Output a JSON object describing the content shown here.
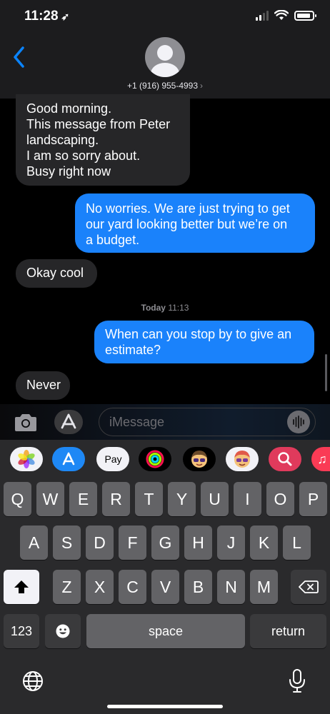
{
  "status_bar": {
    "time": "11:28",
    "location_arrow": "location-arrow-icon"
  },
  "contact": {
    "number": "+1 (916) 955-4993",
    "chevron": "›",
    "back_icon": "chevron-left-icon"
  },
  "messages": [
    {
      "direction": "in",
      "lines": [
        "Good morning.",
        "This message from Peter",
        "landscaping.",
        "I am so sorry about.",
        "Busy right now"
      ]
    },
    {
      "direction": "out",
      "lines": [
        "No worries. We are just trying to get",
        "our yard looking better but we’re on",
        "a budget."
      ]
    },
    {
      "direction": "in",
      "lines": [
        "Okay cool"
      ]
    },
    {
      "direction": "out",
      "lines": [
        "When can you stop by to give an",
        "estimate?"
      ]
    },
    {
      "direction": "in",
      "lines": [
        "Never"
      ]
    }
  ],
  "timestamp": {
    "day": "Today",
    "time": "11:13"
  },
  "input": {
    "placeholder": "iMessage",
    "value": ""
  },
  "app_strip": [
    "photos-icon",
    "app-store-icon",
    "apple-pay-icon",
    "activity-icon",
    "memoji-icon",
    "memoji-stickers-icon",
    "image-search-icon",
    "music-icon"
  ],
  "apple_pay_label": "Pay",
  "keyboard": {
    "row1": [
      "Q",
      "W",
      "E",
      "R",
      "T",
      "Y",
      "U",
      "I",
      "O",
      "P"
    ],
    "row2": [
      "A",
      "S",
      "D",
      "F",
      "G",
      "H",
      "J",
      "K",
      "L"
    ],
    "row3": [
      "Z",
      "X",
      "C",
      "V",
      "B",
      "N",
      "M"
    ],
    "numbers_label": "123",
    "space_label": "space",
    "return_label": "return"
  },
  "colors": {
    "outgoing": "#1a82fb",
    "incoming": "#262628",
    "accent": "#0a84ff"
  }
}
